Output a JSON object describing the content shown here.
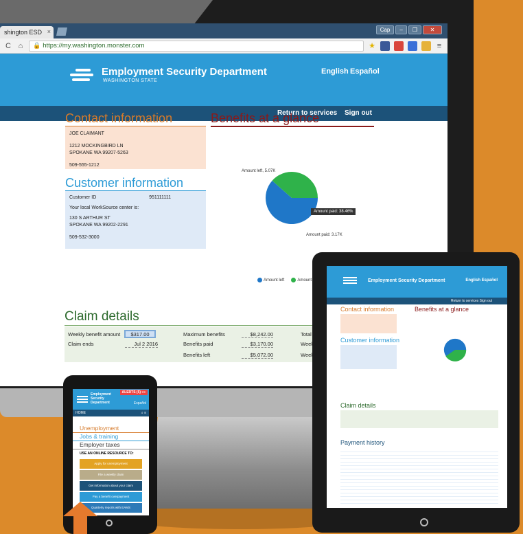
{
  "browser": {
    "tab_title": "shington ESD",
    "tab_close": "×",
    "url": "https://my.washington.monster.com",
    "back": "C",
    "home": "⌂",
    "win_user": "Cap",
    "win_min": "–",
    "win_max": "❐",
    "win_close": "✕"
  },
  "site": {
    "org_name": "Employment Security Department",
    "org_sub": "WASHINGTON STATE",
    "lang_english": "English",
    "lang_espanol": "Español",
    "nav_return": "Return to services",
    "nav_signout": "Sign out"
  },
  "contact": {
    "heading": "Contact information",
    "name": "JOE CLAIMANT",
    "address1": "1212 MOCKINGBIRD LN",
    "address2": "SPOKANE WA 99207-5263",
    "phone": "509-555-1212"
  },
  "customer": {
    "heading": "Customer information",
    "id_label": "Customer ID",
    "id_value": "951111111",
    "worksource_label": "Your local WorkSource center is:",
    "ws_address1": "130 S ARTHUR ST",
    "ws_address2": "SPOKANE WA 99202-2291",
    "ws_phone": "509-532-3000"
  },
  "benefits": {
    "heading": "Benefits at a glance",
    "label_left": "Amount left, 5.07K",
    "label_paid": "Amount paid: 3.17K",
    "tooltip": "Amount paid: 38.46%",
    "legend_left": "Amount left",
    "legend_paid": "Amount"
  },
  "chart_data": {
    "type": "pie",
    "slices": [
      {
        "label": "Amount left",
        "value": 5.07,
        "color": "#1f77c8"
      },
      {
        "label": "Amount paid",
        "value": 3.17,
        "color": "#2fb24a"
      }
    ]
  },
  "claim": {
    "heading": "Claim details",
    "weekly_label": "Weekly benefit amount",
    "weekly_value": "$317.00",
    "claim_ends_label": "Claim ends",
    "claim_ends_value": "Jul 2 2016",
    "max_label": "Maximum benefits",
    "max_value": "$8,242.00",
    "paid_label": "Benefits paid",
    "paid_value": "$3,170.00",
    "left_label": "Benefits left",
    "left_value": "$5,072.00",
    "total_label": "Total w",
    "weeks_label": "Weeks",
    "weeks2_label": "Weeks"
  },
  "tablet": {
    "org_name": "Employment Security Department",
    "lang": "English  Español",
    "nav": "Return to services   Sign out",
    "contact_h": "Contact information",
    "benefits_h": "Benefits at a glance",
    "customer_h": "Customer information",
    "claim_h": "Claim details",
    "payment_h": "Payment history"
  },
  "phone": {
    "alert": "ALERTS (5) »»",
    "brand": "Employment Security Department",
    "lang": "Español",
    "nav_home": "HOME",
    "menu_unemployment": "Unemployment",
    "menu_jobs": "Jobs & training",
    "menu_employer": "Employer taxes",
    "online_label": "USE AN ONLINE RESOURCE TO:",
    "btn_apply": "Apply for unemployment",
    "btn_weekly": "File a weekly claim",
    "btn_info": "Get information about your claim",
    "btn_overpayment": "Pay a benefit overpayment",
    "btn_quarterly": "Quarterly reports with EAMS"
  }
}
